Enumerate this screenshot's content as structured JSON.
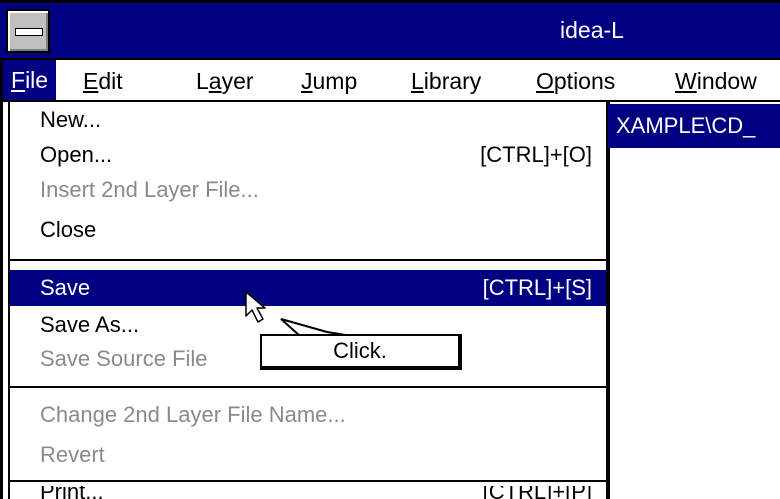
{
  "window": {
    "title": "idea-L"
  },
  "menubar": [
    {
      "label": "File",
      "key": "F",
      "rest": "ile"
    },
    {
      "label": "Edit",
      "key": "E",
      "rest": "dit"
    },
    {
      "label": "Layer",
      "pre": "L",
      "key": "a",
      "rest": "yer"
    },
    {
      "label": "Jump",
      "key": "J",
      "rest": "ump"
    },
    {
      "label": "Library",
      "key": "L",
      "rest": "ibrary"
    },
    {
      "label": "Options",
      "key": "O",
      "rest": "ptions"
    },
    {
      "label": "Window",
      "key": "W",
      "rest": "indow"
    }
  ],
  "path_text": "XAMPLE\\CD_",
  "file_menu": {
    "new": "New...",
    "open": "Open...",
    "open_shortcut": "[CTRL]+[O]",
    "insert": "Insert 2nd Layer File...",
    "close": "Close",
    "save": "Save",
    "save_shortcut": "[CTRL]+[S]",
    "save_as": "Save As...",
    "save_source": "Save Source File",
    "change_name": "Change 2nd Layer File Name...",
    "revert": "Revert",
    "print": "Print...",
    "print_shortcut": "[CTRL]+[P]"
  },
  "callout": {
    "text": "Click."
  },
  "colors": {
    "title_bar": "#000080",
    "selected": "#000080",
    "disabled_text": "#8a8a8a"
  }
}
